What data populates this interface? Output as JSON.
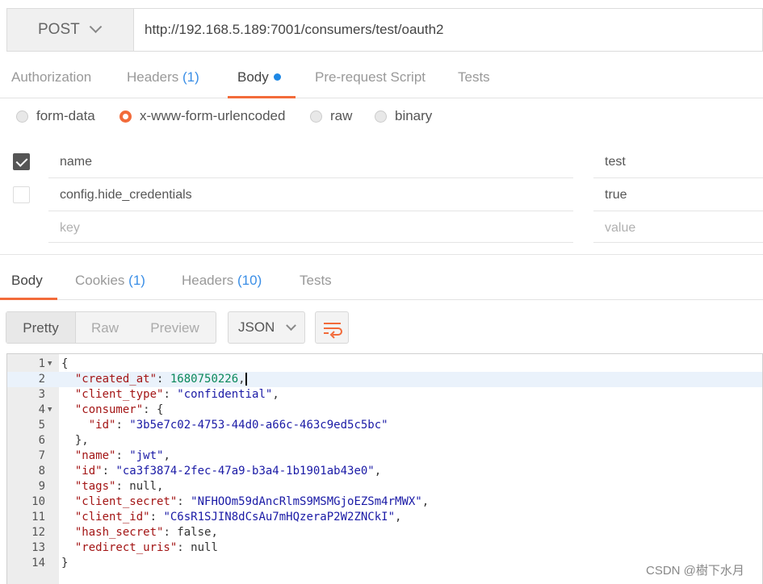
{
  "request": {
    "method": "POST",
    "url": "http://192.168.5.189:7001/consumers/test/oauth2"
  },
  "request_tabs": [
    {
      "label": "Authorization",
      "count": ""
    },
    {
      "label": "Headers",
      "count": "(1)"
    },
    {
      "label": "Body",
      "count": ""
    },
    {
      "label": "Pre-request Script",
      "count": ""
    },
    {
      "label": "Tests",
      "count": ""
    }
  ],
  "body_types": [
    {
      "label": "form-data",
      "selected": false
    },
    {
      "label": "x-www-form-urlencoded",
      "selected": true
    },
    {
      "label": "raw",
      "selected": false
    },
    {
      "label": "binary",
      "selected": false
    }
  ],
  "params": [
    {
      "key": "name",
      "value": "test",
      "checked": true
    },
    {
      "key": "config.hide_credentials",
      "value": "true",
      "checked": false
    }
  ],
  "param_placeholders": {
    "key": "key",
    "value": "value"
  },
  "response_tabs": [
    {
      "label": "Body",
      "count": ""
    },
    {
      "label": "Cookies",
      "count": "(1)"
    },
    {
      "label": "Headers",
      "count": "(10)"
    },
    {
      "label": "Tests",
      "count": ""
    }
  ],
  "view_modes": [
    "Pretty",
    "Raw",
    "Preview"
  ],
  "format": "JSON",
  "code_lines": [
    "{",
    "  \"created_at\": 1680750226,",
    "  \"client_type\": \"confidential\",",
    "  \"consumer\": {",
    "    \"id\": \"3b5e7c02-4753-44d0-a66c-463c9ed5c5bc\"",
    "  },",
    "  \"name\": \"jwt\",",
    "  \"id\": \"ca3f3874-2fec-47a9-b3a4-1b1901ab43e0\",",
    "  \"tags\": null,",
    "  \"client_secret\": \"NFHOOm59dAncRlmS9MSMGjoEZSm4rMWX\",",
    "  \"client_id\": \"C6sR1SJIN8dCsAu7mHQzeraP2W2ZNCkI\",",
    "  \"hash_secret\": false,",
    "  \"redirect_uris\": null",
    "}"
  ],
  "line_numbers": [
    "1",
    "2",
    "3",
    "4",
    "5",
    "6",
    "7",
    "8",
    "9",
    "10",
    "11",
    "12",
    "13",
    "14"
  ],
  "watermark": "CSDN @樹下水月",
  "colors": {
    "accent": "#f26b3a",
    "link": "#3a8ee6",
    "dot": "#1e88e5"
  }
}
